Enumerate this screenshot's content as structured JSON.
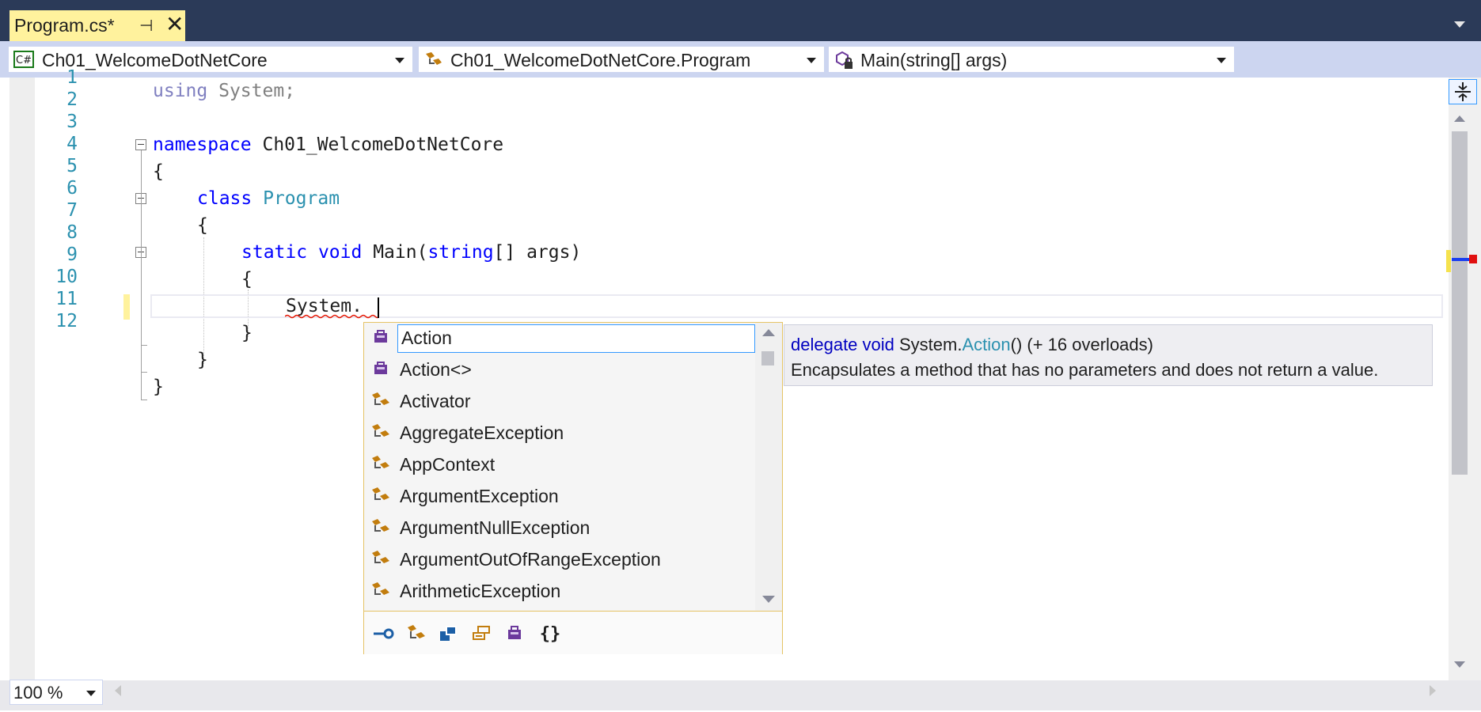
{
  "tab": {
    "title": "Program.cs*",
    "pin_icon": "pin-icon",
    "close_icon": "close-icon"
  },
  "navbar": {
    "project": "Ch01_WelcomeDotNetCore",
    "project_icon_text": "C#",
    "type": "Ch01_WelcomeDotNetCore.Program",
    "member": "Main(string[] args)"
  },
  "code": {
    "line_numbers": [
      "1",
      "2",
      "3",
      "4",
      "5",
      "6",
      "7",
      "8",
      "9",
      "10",
      "11",
      "12"
    ],
    "l1_kw": "using",
    "l1_rest": " System;",
    "l3_kw": "namespace",
    "l3_rest": " Ch01_WelcomeDotNetCore",
    "l4": "{",
    "l5_kw": "class",
    "l5_type": "Program",
    "l6": "{",
    "l7_kw1": "static",
    "l7_kw2": "void",
    "l7_name": "Main(",
    "l7_kw3": "string",
    "l7_rest": "[] args)",
    "l8": "{",
    "l9": "System.",
    "l10": "}",
    "l11": "}",
    "l12": "}"
  },
  "completion": {
    "items": [
      {
        "label": "Action",
        "icon": "delegate-icon"
      },
      {
        "label": "Action<>",
        "icon": "delegate-icon"
      },
      {
        "label": "Activator",
        "icon": "class-icon"
      },
      {
        "label": "AggregateException",
        "icon": "class-icon"
      },
      {
        "label": "AppContext",
        "icon": "class-icon"
      },
      {
        "label": "ArgumentException",
        "icon": "class-icon"
      },
      {
        "label": "ArgumentNullException",
        "icon": "class-icon"
      },
      {
        "label": "ArgumentOutOfRangeException",
        "icon": "class-icon"
      },
      {
        "label": "ArithmeticException",
        "icon": "class-icon"
      }
    ],
    "selected_index": 0,
    "filters": [
      "interface-filter-icon",
      "class-filter-icon",
      "struct-filter-icon",
      "enum-filter-icon",
      "delegate-filter-icon",
      "namespace-filter-icon"
    ]
  },
  "tooltip": {
    "kw": "delegate void",
    "ns": " System.",
    "type": "Action",
    "rest": "() (+ 16 overloads)",
    "description": "Encapsulates a method that has no parameters and does not return a value."
  },
  "zoom": {
    "value": "100 %"
  },
  "colors": {
    "tab_active": "#fff29d",
    "tab_strip": "#2b3a58",
    "navbar": "#ccd5f0",
    "keyword": "#0000ff",
    "type": "#2b91af",
    "popup_border": "#e5c365"
  }
}
